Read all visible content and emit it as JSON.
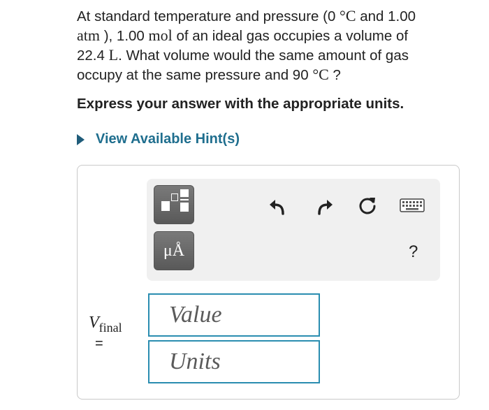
{
  "question": {
    "p1": "At standard temperature and pressure (0 ",
    "deg1": "°C",
    "p2": " and 1.00",
    "atm": "atm",
    "p3": " ), 1.00 ",
    "mol": "mol",
    "p4": " of an ideal gas occupies a volume of",
    "p5": "22.4 ",
    "L": "L",
    "p6": ". What volume would the same amount of gas",
    "p7": "occupy at the same pressure and 90 ",
    "deg2": "°C",
    "p8": " ?"
  },
  "instruction": "Express your answer with the appropriate units.",
  "hint": {
    "label": "View Available Hint(s)"
  },
  "toolbar": {
    "templates_icon": "templates-icon",
    "units_symbol": "μÅ",
    "undo_icon": "undo-arrow-icon",
    "redo_icon": "redo-arrow-icon",
    "reset_icon": "reset-icon",
    "keyboard_icon": "keyboard-icon",
    "help": "?"
  },
  "answer": {
    "var_letter": "V",
    "var_sub": "final",
    "equals": "=",
    "value_placeholder": "Value",
    "units_placeholder": "Units"
  }
}
